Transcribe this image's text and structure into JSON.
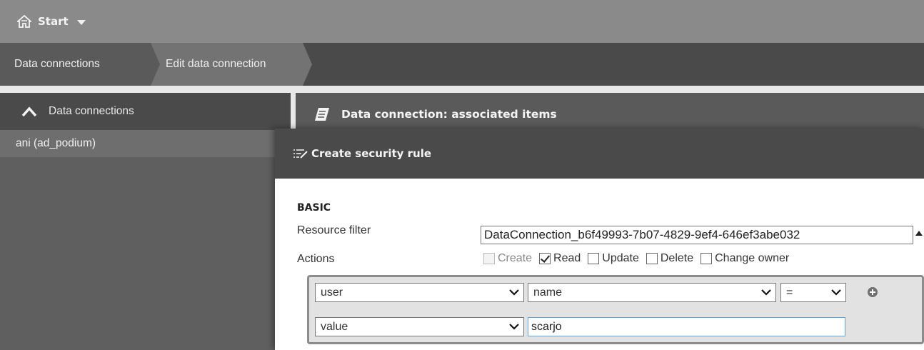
{
  "topbar": {
    "start_label": "Start",
    "icon": "home-icon"
  },
  "breadcrumb": {
    "items": [
      "Data connections",
      "Edit data connection"
    ]
  },
  "sidebar": {
    "header_label": "Data connections",
    "items": [
      "ani (ad_podium)"
    ]
  },
  "main": {
    "header_title": "Data connection: associated items"
  },
  "dialog": {
    "title": "Create security rule",
    "section": "BASIC",
    "resource_filter_label": "Resource filter",
    "resource_filter_value": "DataConnection_b6f49993-7b07-4829-9ef4-646ef3abe032",
    "actions_label": "Actions",
    "actions": [
      {
        "label": "Create",
        "checked": false,
        "disabled": true
      },
      {
        "label": "Read",
        "checked": true,
        "disabled": false
      },
      {
        "label": "Update",
        "checked": false,
        "disabled": false
      },
      {
        "label": "Delete",
        "checked": false,
        "disabled": false
      },
      {
        "label": "Change owner",
        "checked": false,
        "disabled": false
      }
    ],
    "condition": {
      "row1": {
        "left": "user",
        "right": "name",
        "operator": "="
      },
      "row2": {
        "left": "value",
        "value": "scarjo"
      }
    }
  },
  "colors": {
    "topbar": "#8a8a8a",
    "crumbbar": "#4a4a4a",
    "dialog_header": "#4a4a4a",
    "input_focus": "#5aa6e0"
  }
}
